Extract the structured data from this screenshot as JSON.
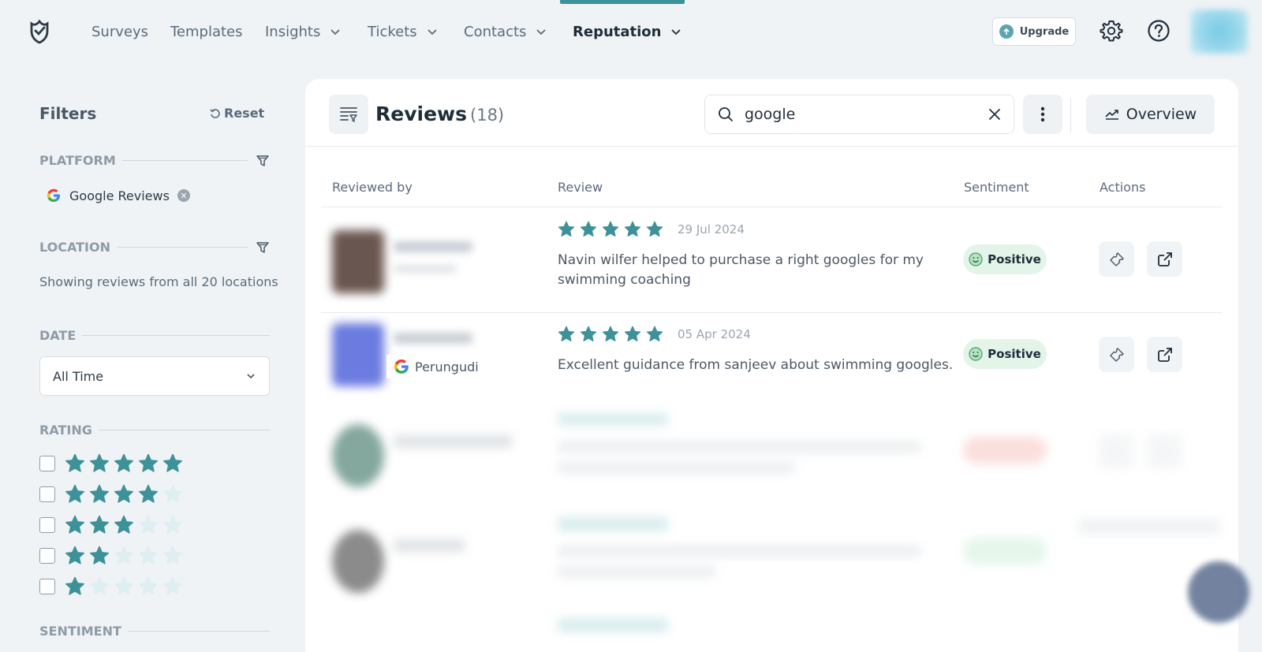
{
  "nav": {
    "items": [
      {
        "label": "Surveys"
      },
      {
        "label": "Templates"
      },
      {
        "label": "Insights"
      },
      {
        "label": "Tickets"
      },
      {
        "label": "Contacts"
      },
      {
        "label": "Reputation"
      }
    ],
    "active": "Reputation",
    "upgrade_label": "Upgrade",
    "accent": "#3d9199"
  },
  "filters": {
    "title": "Filters",
    "reset_label": "Reset",
    "platform": {
      "label": "PLATFORM",
      "chip": "Google Reviews"
    },
    "location": {
      "label": "LOCATION",
      "text": "Showing reviews from all 20 locations"
    },
    "date": {
      "label": "DATE",
      "selected": "All Time"
    },
    "rating": {
      "label": "RATING",
      "options": [
        5,
        4,
        3,
        2,
        1
      ]
    },
    "sentiment": {
      "label": "SENTIMENT"
    }
  },
  "reviews": {
    "title": "Reviews",
    "count": "(18)",
    "search_value": "google",
    "overview_label": "Overview",
    "columns": {
      "reviewed_by": "Reviewed by",
      "review": "Review",
      "sentiment": "Sentiment",
      "actions": "Actions"
    },
    "rows": [
      {
        "rating": 5,
        "date": "29 Jul 2024",
        "text": "Navin wilfer helped to purchase a right googles for my swimming coaching",
        "sentiment": "Positive"
      },
      {
        "rating": 5,
        "date": "05 Apr 2024",
        "text": "Excellent guidance from sanjeev about swimming googles.",
        "sentiment": "Positive",
        "location": "Perungudi"
      }
    ]
  },
  "colors": {
    "star_filled": "#3d9199",
    "star_empty": "#dfeef0",
    "positive_bg": "#e3f5e9"
  }
}
